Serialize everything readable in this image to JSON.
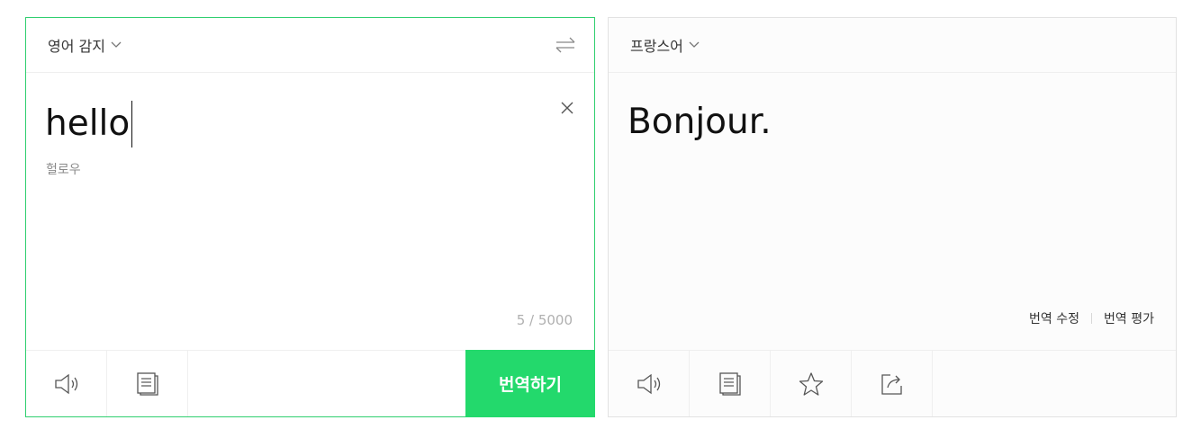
{
  "source": {
    "language": "영어 감지",
    "text": "hello",
    "pronunciation": "헐로우",
    "char_count": "5 / 5000",
    "translate_button": "번역하기"
  },
  "target": {
    "language": "프랑스어",
    "text": "Bonjour.",
    "edit_link": "번역 수정",
    "rate_link": "번역 평가"
  },
  "icons": {
    "source_footer": [
      "speaker-icon",
      "copy-icon"
    ],
    "target_footer": [
      "speaker-icon",
      "copy-icon",
      "star-icon",
      "share-icon"
    ]
  },
  "colors": {
    "accent": "#23d96c",
    "source_border": "#2fcf6f"
  }
}
